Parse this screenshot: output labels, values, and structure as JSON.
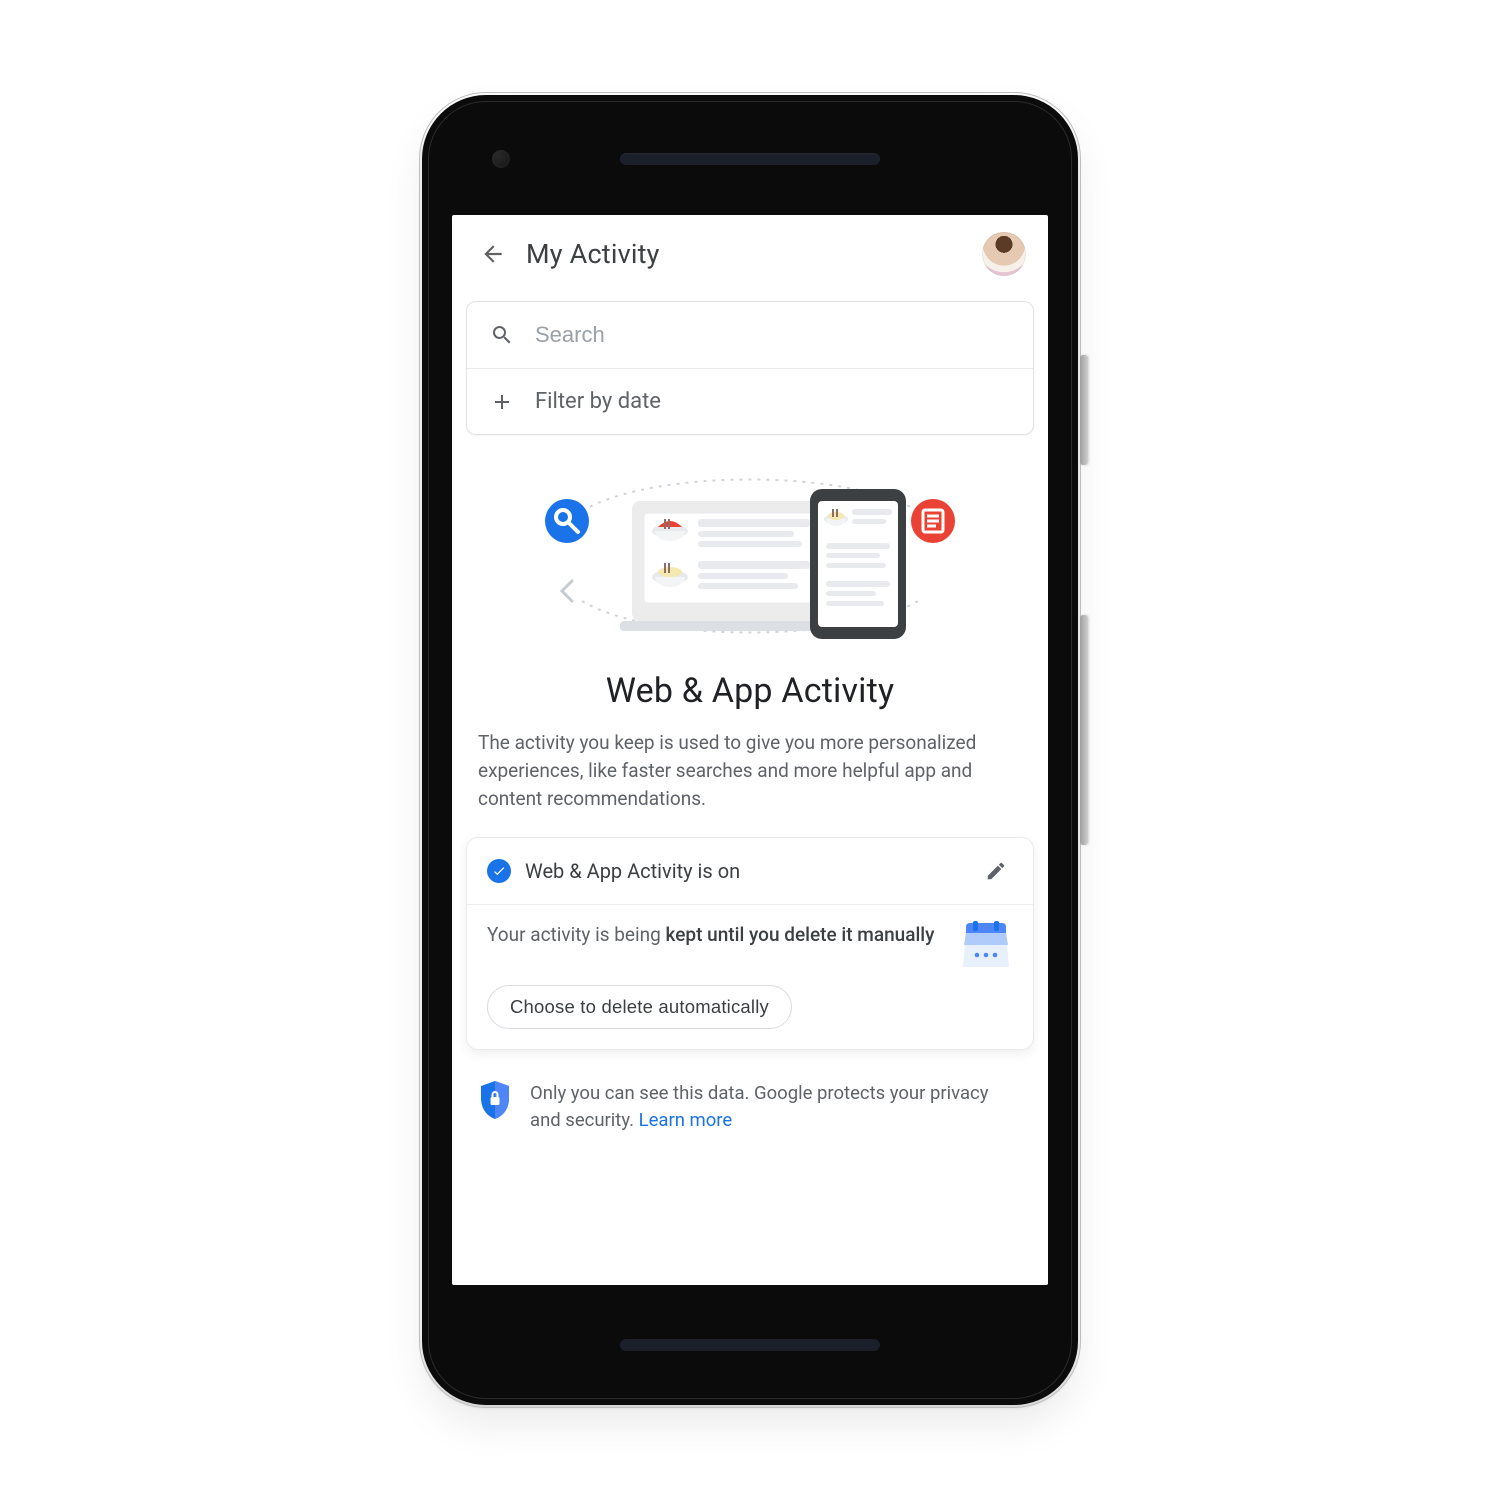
{
  "header": {
    "title": "My Activity"
  },
  "search": {
    "placeholder": "Search"
  },
  "filter": {
    "label": "Filter by date"
  },
  "hero": {
    "title": "Web & App Activity",
    "description": "The activity you keep is used to give you more personalized experiences, like faster searches and more helpful app and content recommendations."
  },
  "status": {
    "on_label": "Web & App Activity is on",
    "keep_prefix": "Your activity is being ",
    "keep_bold": "kept until you delete it manually",
    "choose_label": "Choose to delete automatically"
  },
  "privacy": {
    "text": "Only you can see this data. Google protects your privacy and security. ",
    "learn_more": "Learn more"
  },
  "colors": {
    "primary": "#1a73e8",
    "text": "#3c4043",
    "muted": "#5f6368"
  }
}
